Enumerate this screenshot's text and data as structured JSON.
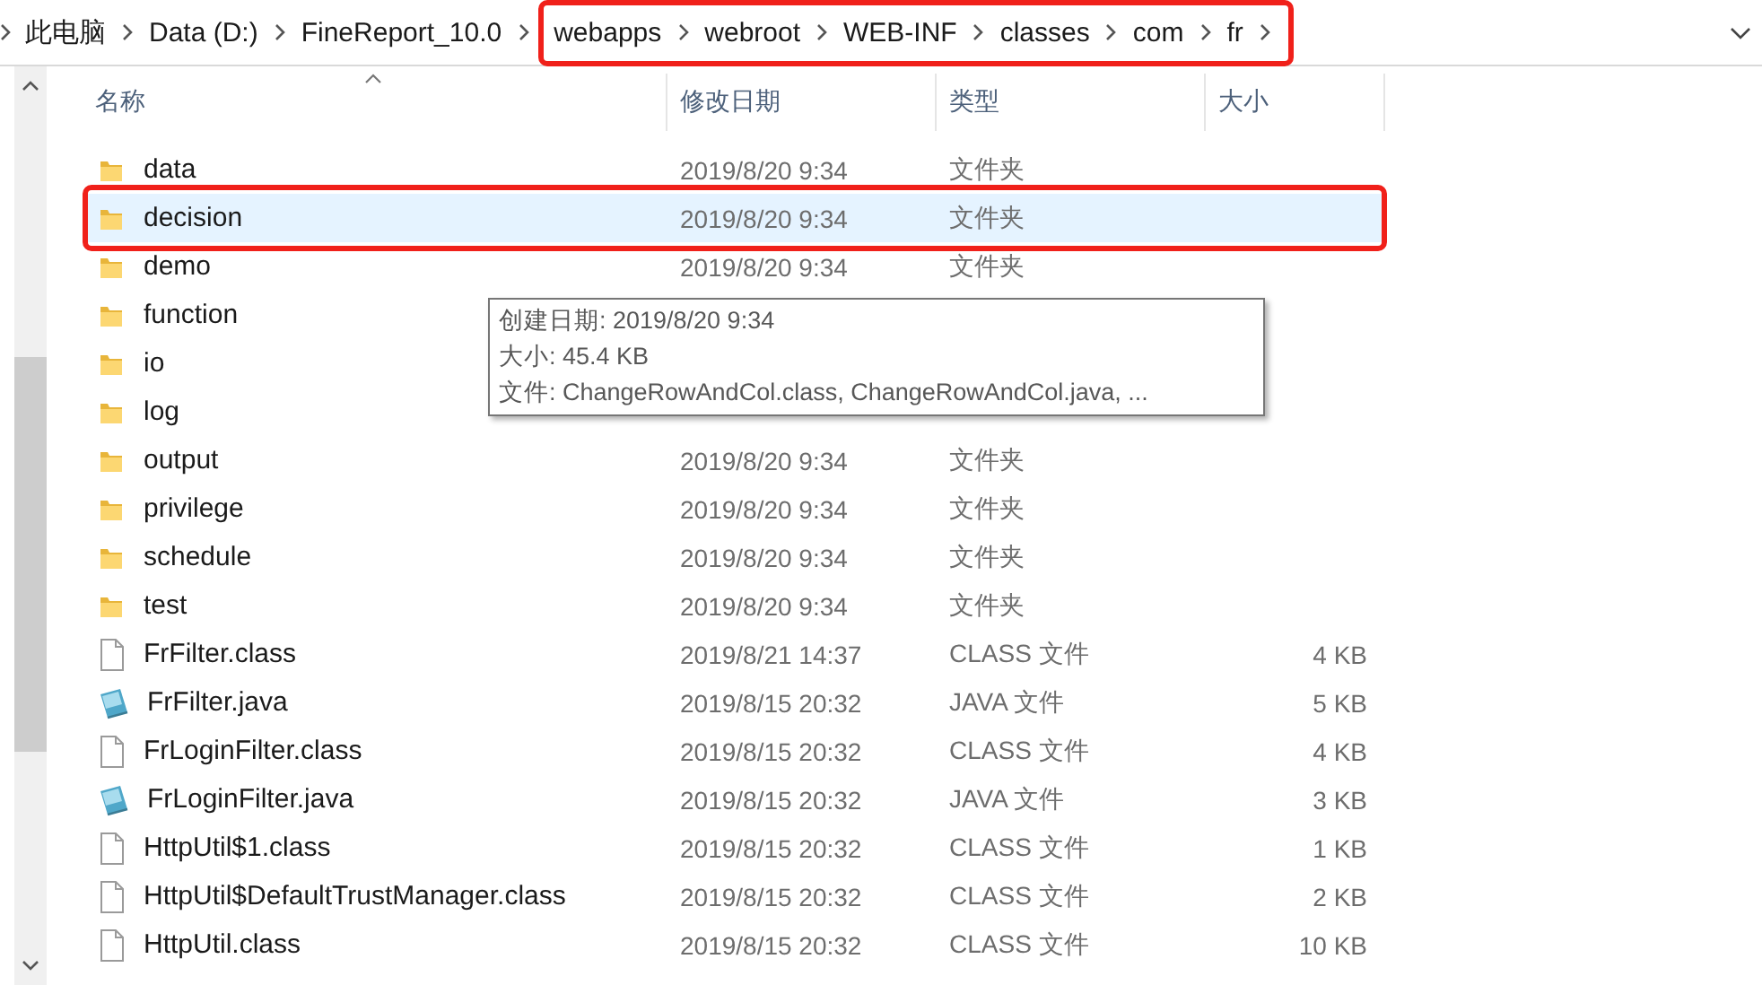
{
  "breadcrumb": [
    "此电脑",
    "Data (D:)",
    "FineReport_10.0",
    "webapps",
    "webroot",
    "WEB-INF",
    "classes",
    "com",
    "fr"
  ],
  "columns": [
    "名称",
    "修改日期",
    "类型",
    "大小"
  ],
  "rows": [
    {
      "kind": "folder",
      "name": "data",
      "date": "2019/8/20 9:34",
      "type": "文件夹",
      "selected": false
    },
    {
      "kind": "folder",
      "name": "decision",
      "date": "2019/8/20 9:34",
      "type": "文件夹",
      "selected": true
    },
    {
      "kind": "folder",
      "name": "demo",
      "date": "2019/8/20 9:34",
      "type": "文件夹",
      "selected": false
    },
    {
      "kind": "folder",
      "name": "function",
      "selected": false
    },
    {
      "kind": "folder",
      "name": "io",
      "selected": false
    },
    {
      "kind": "folder",
      "name": "log",
      "selected": false
    },
    {
      "kind": "folder",
      "name": "output",
      "date": "2019/8/20 9:34",
      "type": "文件夹",
      "selected": false
    },
    {
      "kind": "folder",
      "name": "privilege",
      "date": "2019/8/20 9:34",
      "type": "文件夹",
      "selected": false
    },
    {
      "kind": "folder",
      "name": "schedule",
      "date": "2019/8/20 9:34",
      "type": "文件夹",
      "selected": false
    },
    {
      "kind": "folder",
      "name": "test",
      "date": "2019/8/20 9:34",
      "type": "文件夹",
      "selected": false
    },
    {
      "kind": "class",
      "name": "FrFilter.class",
      "date": "2019/8/21 14:37",
      "type": "CLASS 文件",
      "size": "4 KB",
      "selected": false
    },
    {
      "kind": "java",
      "name": "FrFilter.java",
      "date": "2019/8/15 20:32",
      "type": "JAVA 文件",
      "size": "5 KB",
      "selected": false
    },
    {
      "kind": "class",
      "name": "FrLoginFilter.class",
      "date": "2019/8/15 20:32",
      "type": "CLASS 文件",
      "size": "4 KB",
      "selected": false
    },
    {
      "kind": "java",
      "name": "FrLoginFilter.java",
      "date": "2019/8/15 20:32",
      "type": "JAVA 文件",
      "size": "3 KB",
      "selected": false
    },
    {
      "kind": "class",
      "name": "HttpUtil$1.class",
      "date": "2019/8/15 20:32",
      "type": "CLASS 文件",
      "size": "1 KB",
      "selected": false
    },
    {
      "kind": "class",
      "name": "HttpUtil$DefaultTrustManager.class",
      "date": "2019/8/15 20:32",
      "type": "CLASS 文件",
      "size": "2 KB",
      "selected": false
    },
    {
      "kind": "class",
      "name": "HttpUtil.class",
      "date": "2019/8/15 20:32",
      "type": "CLASS 文件",
      "size": "10 KB",
      "selected": false
    }
  ],
  "tooltip": [
    "创建日期: 2019/8/20 9:34",
    "大小: 45.4 KB",
    "文件: ChangeRowAndCol.class, ChangeRowAndCol.java, ..."
  ]
}
